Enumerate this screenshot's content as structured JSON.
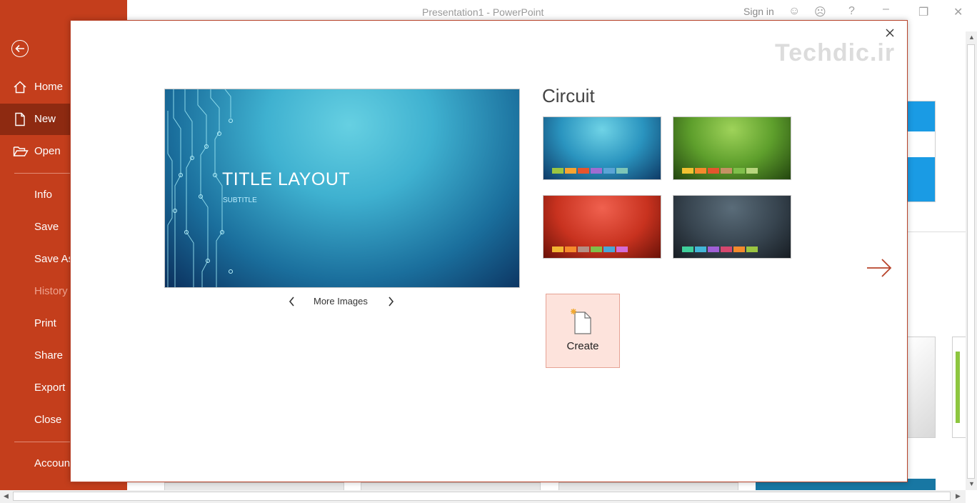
{
  "window": {
    "title": "Presentation1  -  PowerPoint",
    "sign_in": "Sign in"
  },
  "sidebar": {
    "accent_color": "#c43e1c",
    "items": [
      {
        "label": "Home",
        "icon": "home-icon"
      },
      {
        "label": "New",
        "icon": "new-document-icon",
        "selected": true
      },
      {
        "label": "Open",
        "icon": "folder-open-icon"
      },
      {
        "label": "Info"
      },
      {
        "label": "Save"
      },
      {
        "label": "Save As"
      },
      {
        "label": "History",
        "disabled": true
      },
      {
        "label": "Print"
      },
      {
        "label": "Share"
      },
      {
        "label": "Export"
      },
      {
        "label": "Close"
      },
      {
        "label": "Account"
      }
    ]
  },
  "dialog": {
    "watermark": "Techdic.ir",
    "preview": {
      "title": "TITLE LAYOUT",
      "subtitle": "SUBTITLE"
    },
    "more_images": "More Images",
    "theme_name": "Circuit",
    "variants": [
      {
        "name": "blue",
        "swatches": [
          "#9bc541",
          "#f7a431",
          "#e5552d",
          "#9f6dd1",
          "#5aa4d6",
          "#7dc6b8"
        ]
      },
      {
        "name": "green",
        "swatches": [
          "#f1c232",
          "#f58a2c",
          "#e4552d",
          "#c49264",
          "#7fbf4a",
          "#b8d67e"
        ]
      },
      {
        "name": "red",
        "swatches": [
          "#f2b632",
          "#f58a2c",
          "#b58f84",
          "#7fbf4a",
          "#4aa6d6",
          "#d46bd6"
        ]
      },
      {
        "name": "dark",
        "swatches": [
          "#3fcf9b",
          "#42b6d8",
          "#a05fd6",
          "#d6476e",
          "#f58a2c",
          "#9bc541"
        ]
      }
    ],
    "create_label": "Create"
  }
}
